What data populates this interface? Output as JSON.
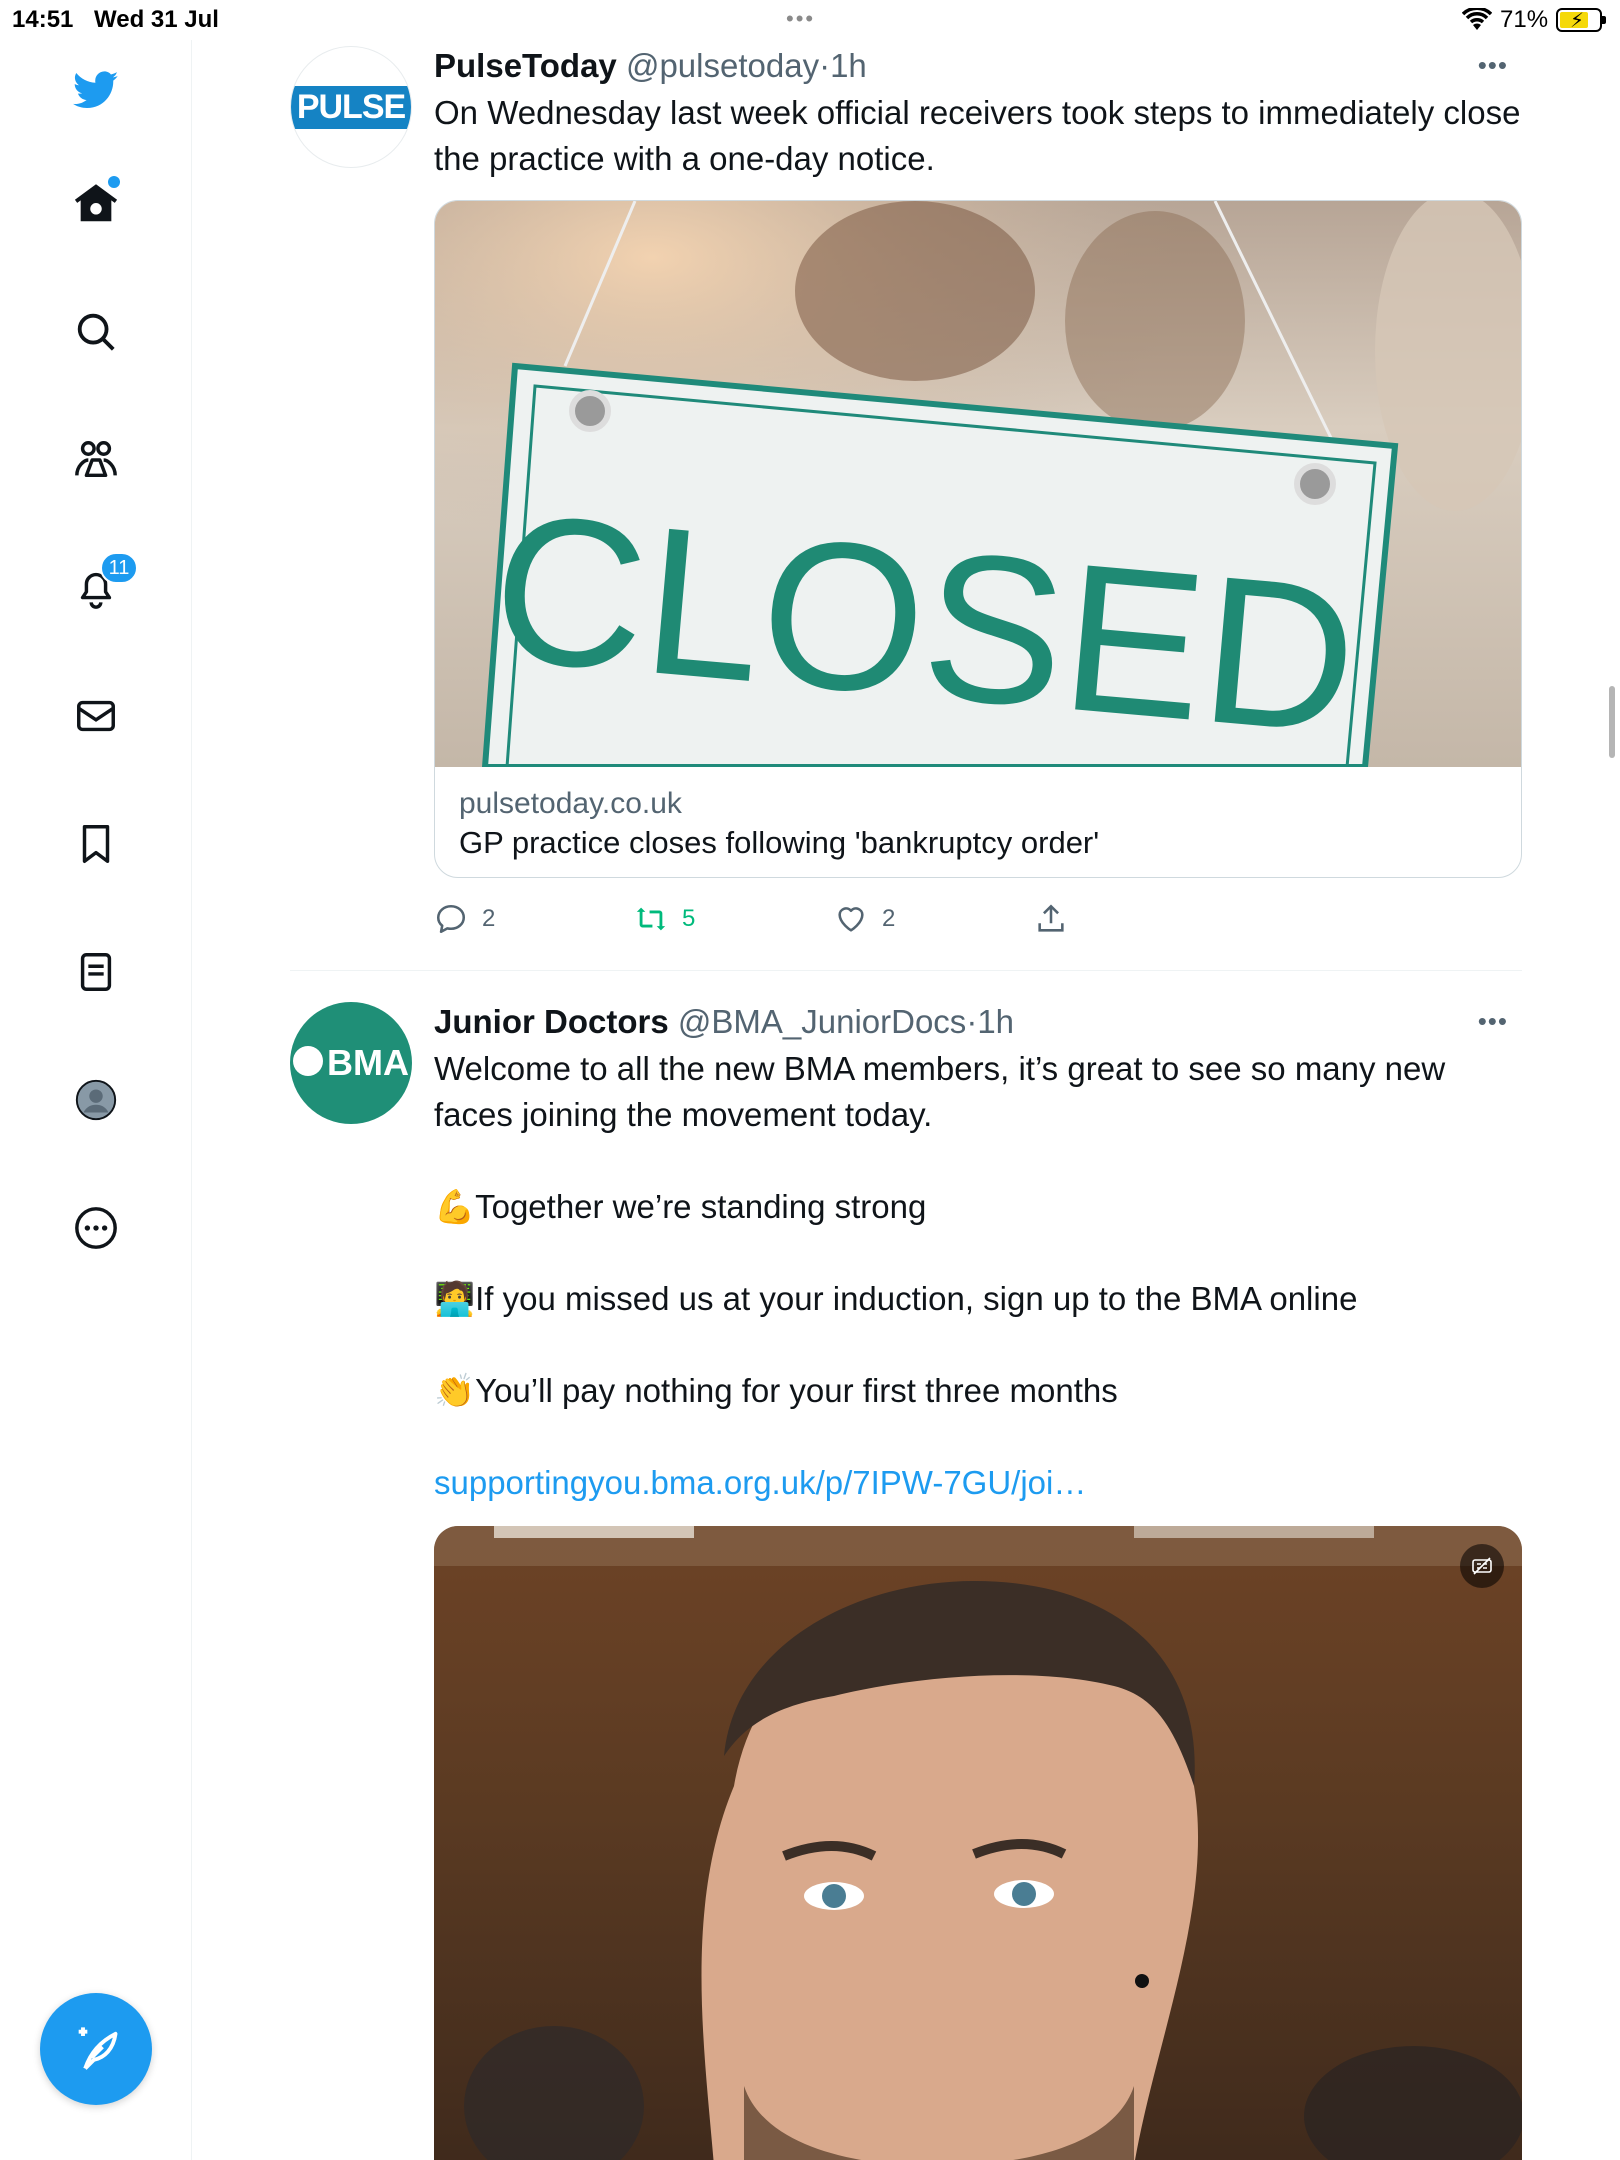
{
  "status_bar": {
    "time": "14:51",
    "date": "Wed 31 Jul",
    "battery_percent": "71%",
    "battery_level": 0.71
  },
  "sidebar": {
    "notifications_badge": "11",
    "accent_color": "#1d9bf0"
  },
  "tweets": [
    {
      "name": "PulseToday",
      "handle": "@pulsetoday",
      "separator": "·",
      "time": "1h",
      "avatar_text": "PULSE",
      "text_lines": [
        "On Wednesday last week official receivers took steps to immediately close the practice with a one-day notice."
      ],
      "card": {
        "image_text": "CLOSED",
        "domain": "pulsetoday.co.uk",
        "title": "GP practice closes following 'bankruptcy order'"
      },
      "replies": "2",
      "retweets": "5",
      "likes": "2"
    },
    {
      "name": "Junior Doctors",
      "handle": "@BMA_JuniorDocs",
      "separator": "·",
      "time": "1h",
      "avatar_text": "BMA",
      "paragraphs": [
        "Welcome to all the new BMA members, it’s great to see so many new faces joining the movement today.",
        "💪Together we’re standing strong",
        "🧑‍💻If you missed us at your induction, sign up to the BMA online",
        "👏You’ll pay nothing for your first three months"
      ],
      "link": "supportingyou.bma.org.uk/p/7IPW-7GU/joi…"
    }
  ]
}
